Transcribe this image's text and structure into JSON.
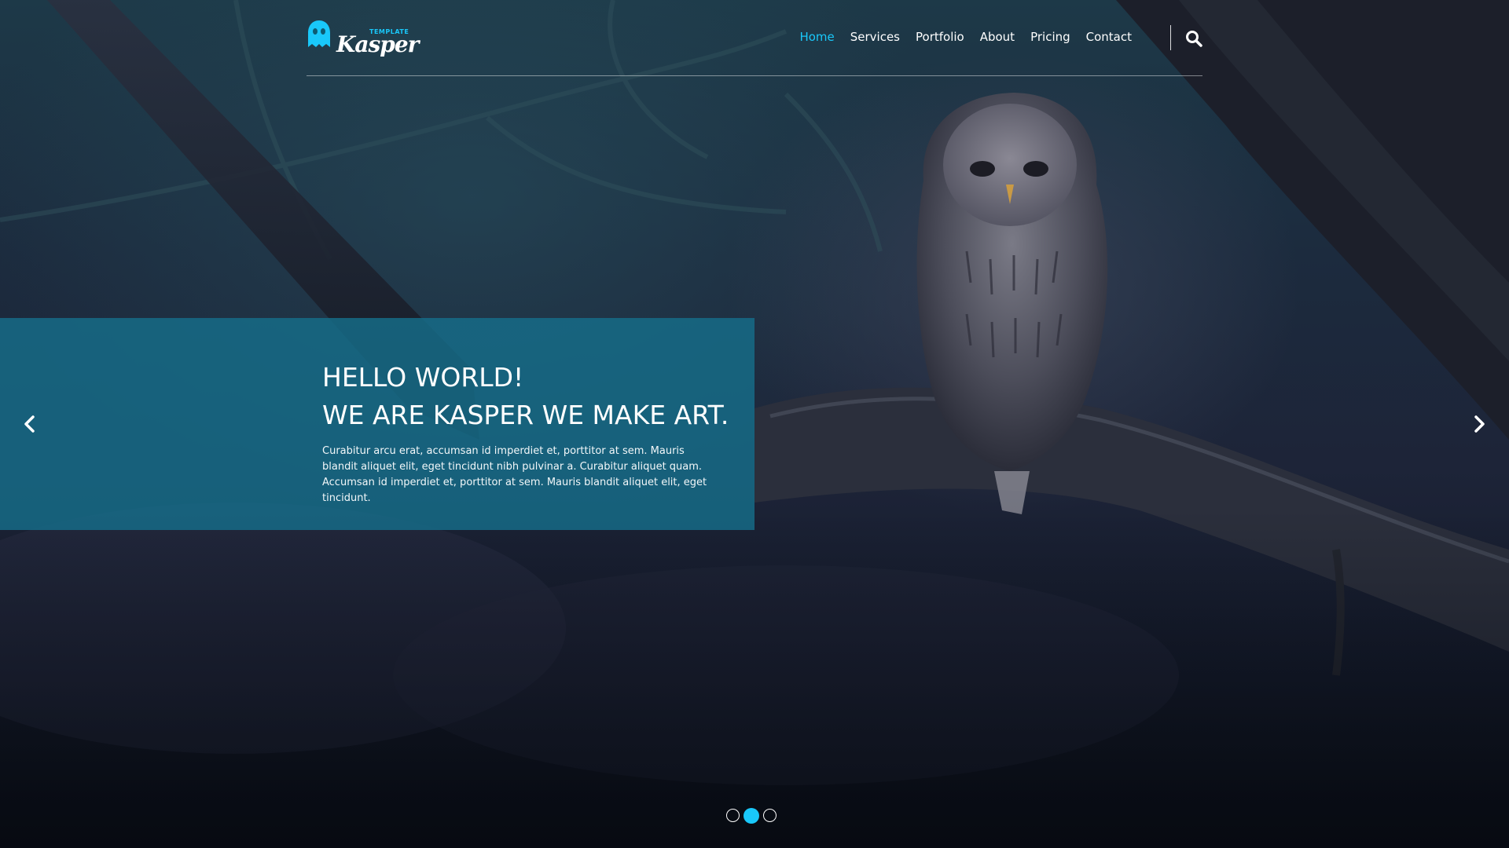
{
  "brand": {
    "logo_tag": "TEMPLATE",
    "logo_word": "Kasper",
    "accent_color": "#19c8fa"
  },
  "nav": {
    "items": [
      {
        "label": "Home",
        "active": true
      },
      {
        "label": "Services",
        "active": false
      },
      {
        "label": "Portfolio",
        "active": false
      },
      {
        "label": "About",
        "active": false
      },
      {
        "label": "Pricing",
        "active": false
      },
      {
        "label": "Contact",
        "active": false
      }
    ],
    "search_icon": "search-icon"
  },
  "slide": {
    "title_line1": "HELLO WORLD!",
    "title_line2": "WE ARE KASPER WE MAKE ART.",
    "text": "Curabitur arcu erat, accumsan id imperdiet et, porttitor at sem. Mauris blandit aliquet elit, eget tincidunt nibh pulvinar a. Curabitur aliquet quam. Accumsan id imperdiet et, porttitor at sem. Mauris blandit aliquet elit, eget tincidunt.",
    "panel_color": "#166e8a"
  },
  "carousel": {
    "prev_icon": "chevron-left-icon",
    "next_icon": "chevron-right-icon",
    "slide_count": 3,
    "active_index": 1
  }
}
